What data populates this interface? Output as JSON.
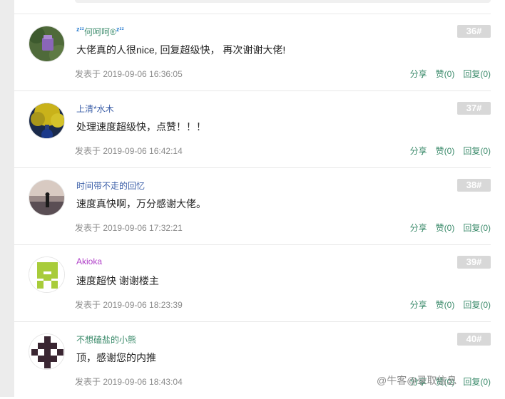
{
  "comments": [
    {
      "username": "何呵呵®",
      "user_prefix": "z",
      "user_suffix": "z",
      "user_color": "#3a8a6a",
      "floor": "36#",
      "content": "大佬真的人很nice, 回复超级快， 再次谢谢大佬!",
      "time": "发表于 2019-09-06 16:36:05",
      "share": "分享",
      "like": "赞(0)",
      "reply": "回复(0)"
    },
    {
      "username": "上清*水木",
      "user_color": "#3c5fa8",
      "floor": "37#",
      "content": "处理速度超级快，点赞！！！",
      "time": "发表于 2019-09-06 16:42:14",
      "share": "分享",
      "like": "赞(0)",
      "reply": "回复(0)"
    },
    {
      "username": "时间带不走的回忆",
      "user_color": "#3c5fa8",
      "floor": "38#",
      "content": "速度真快啊，万分感谢大佬。",
      "time": "发表于 2019-09-06 17:32:21",
      "share": "分享",
      "like": "赞(0)",
      "reply": "回复(0)"
    },
    {
      "username": "Akioka",
      "user_color": "#b040c8",
      "floor": "39#",
      "content": "速度超快 谢谢楼主",
      "time": "发表于 2019-09-06 18:23:39",
      "share": "分享",
      "like": "赞(0)",
      "reply": "回复(0)"
    },
    {
      "username": "不想磕盐的小熊",
      "user_color": "#3a8a6a",
      "floor": "40#",
      "content": "顶，感谢您的内推",
      "time": "发表于 2019-09-06 18:43:04",
      "share": "分享",
      "like": "赞(0)",
      "reply": "回复(0)"
    }
  ],
  "watermark": "@牛客@录取信息"
}
